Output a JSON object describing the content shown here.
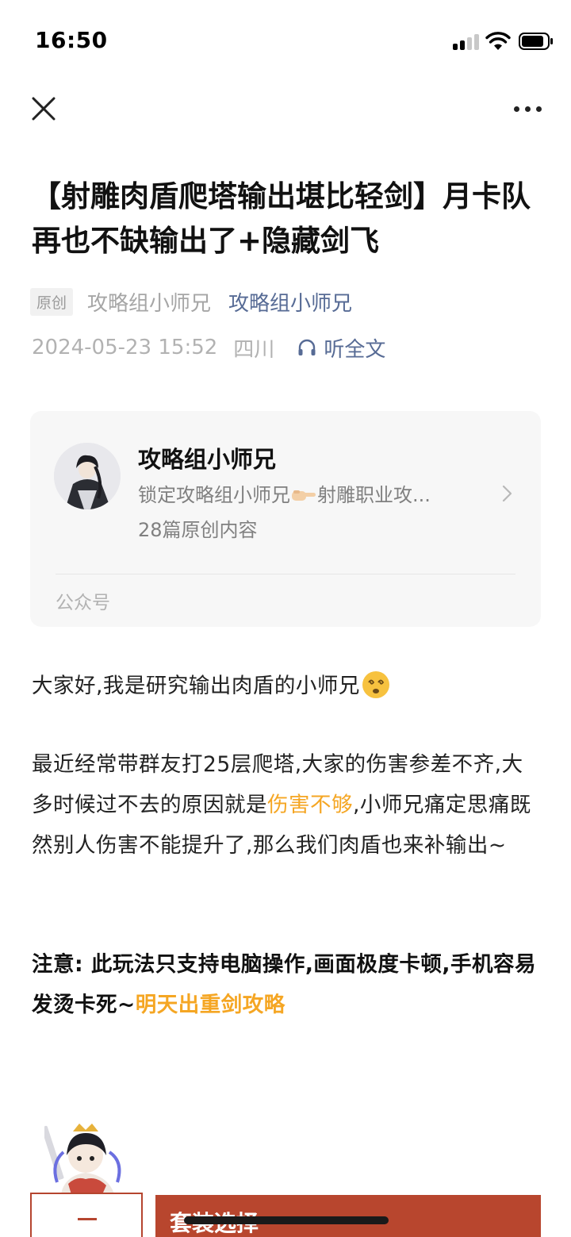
{
  "status_bar": {
    "time": "16:50",
    "signal_icon": "cellular-signal-icon",
    "wifi_icon": "wifi-icon",
    "battery_icon": "battery-icon"
  },
  "nav": {
    "close_icon": "close-icon",
    "more_icon": "more-dots-icon"
  },
  "article": {
    "title": "【射雕肉盾爬塔输出堪比轻剑】月卡队再也不缺输出了+隐藏剑飞",
    "original_tag": "原创",
    "author": "攻略组小师兄",
    "account": "攻略组小师兄",
    "date": "2024-05-23 15:52",
    "region": "四川",
    "listen_label": "听全文"
  },
  "account_card": {
    "name": "攻略组小师兄",
    "desc_before_emoji": "锁定攻略组小师兄",
    "desc_after_emoji": "射雕职业攻...",
    "desc_emoji": "pointing-hand-emoji",
    "count": "28篇原创内容",
    "footer": "公众号",
    "chevron_icon": "chevron-right-icon"
  },
  "content": {
    "p1_text": "大家好,我是研究输出肉盾的小师兄",
    "p1_emoji": "dizzy-face-emoji",
    "p2_before": "最近经常带群友打25层爬塔,大家的伤害参差不齐,大多时候过不去的原因就是",
    "p2_highlight": "伤害不够",
    "p2_after": ",小师兄痛定思痛既然别人伤害不能提升了,那么我们肉盾也来补输出~",
    "p3_before": "注意: 此玩法只支持电脑操作,画面极度卡顿,手机容易发烫卡死~",
    "p3_highlight": "明天出重剑攻略",
    "highlight_color": "#f5a623"
  },
  "section": {
    "number_label": "一",
    "banner_label": "套装选择",
    "banner_color": "#b8462e"
  }
}
